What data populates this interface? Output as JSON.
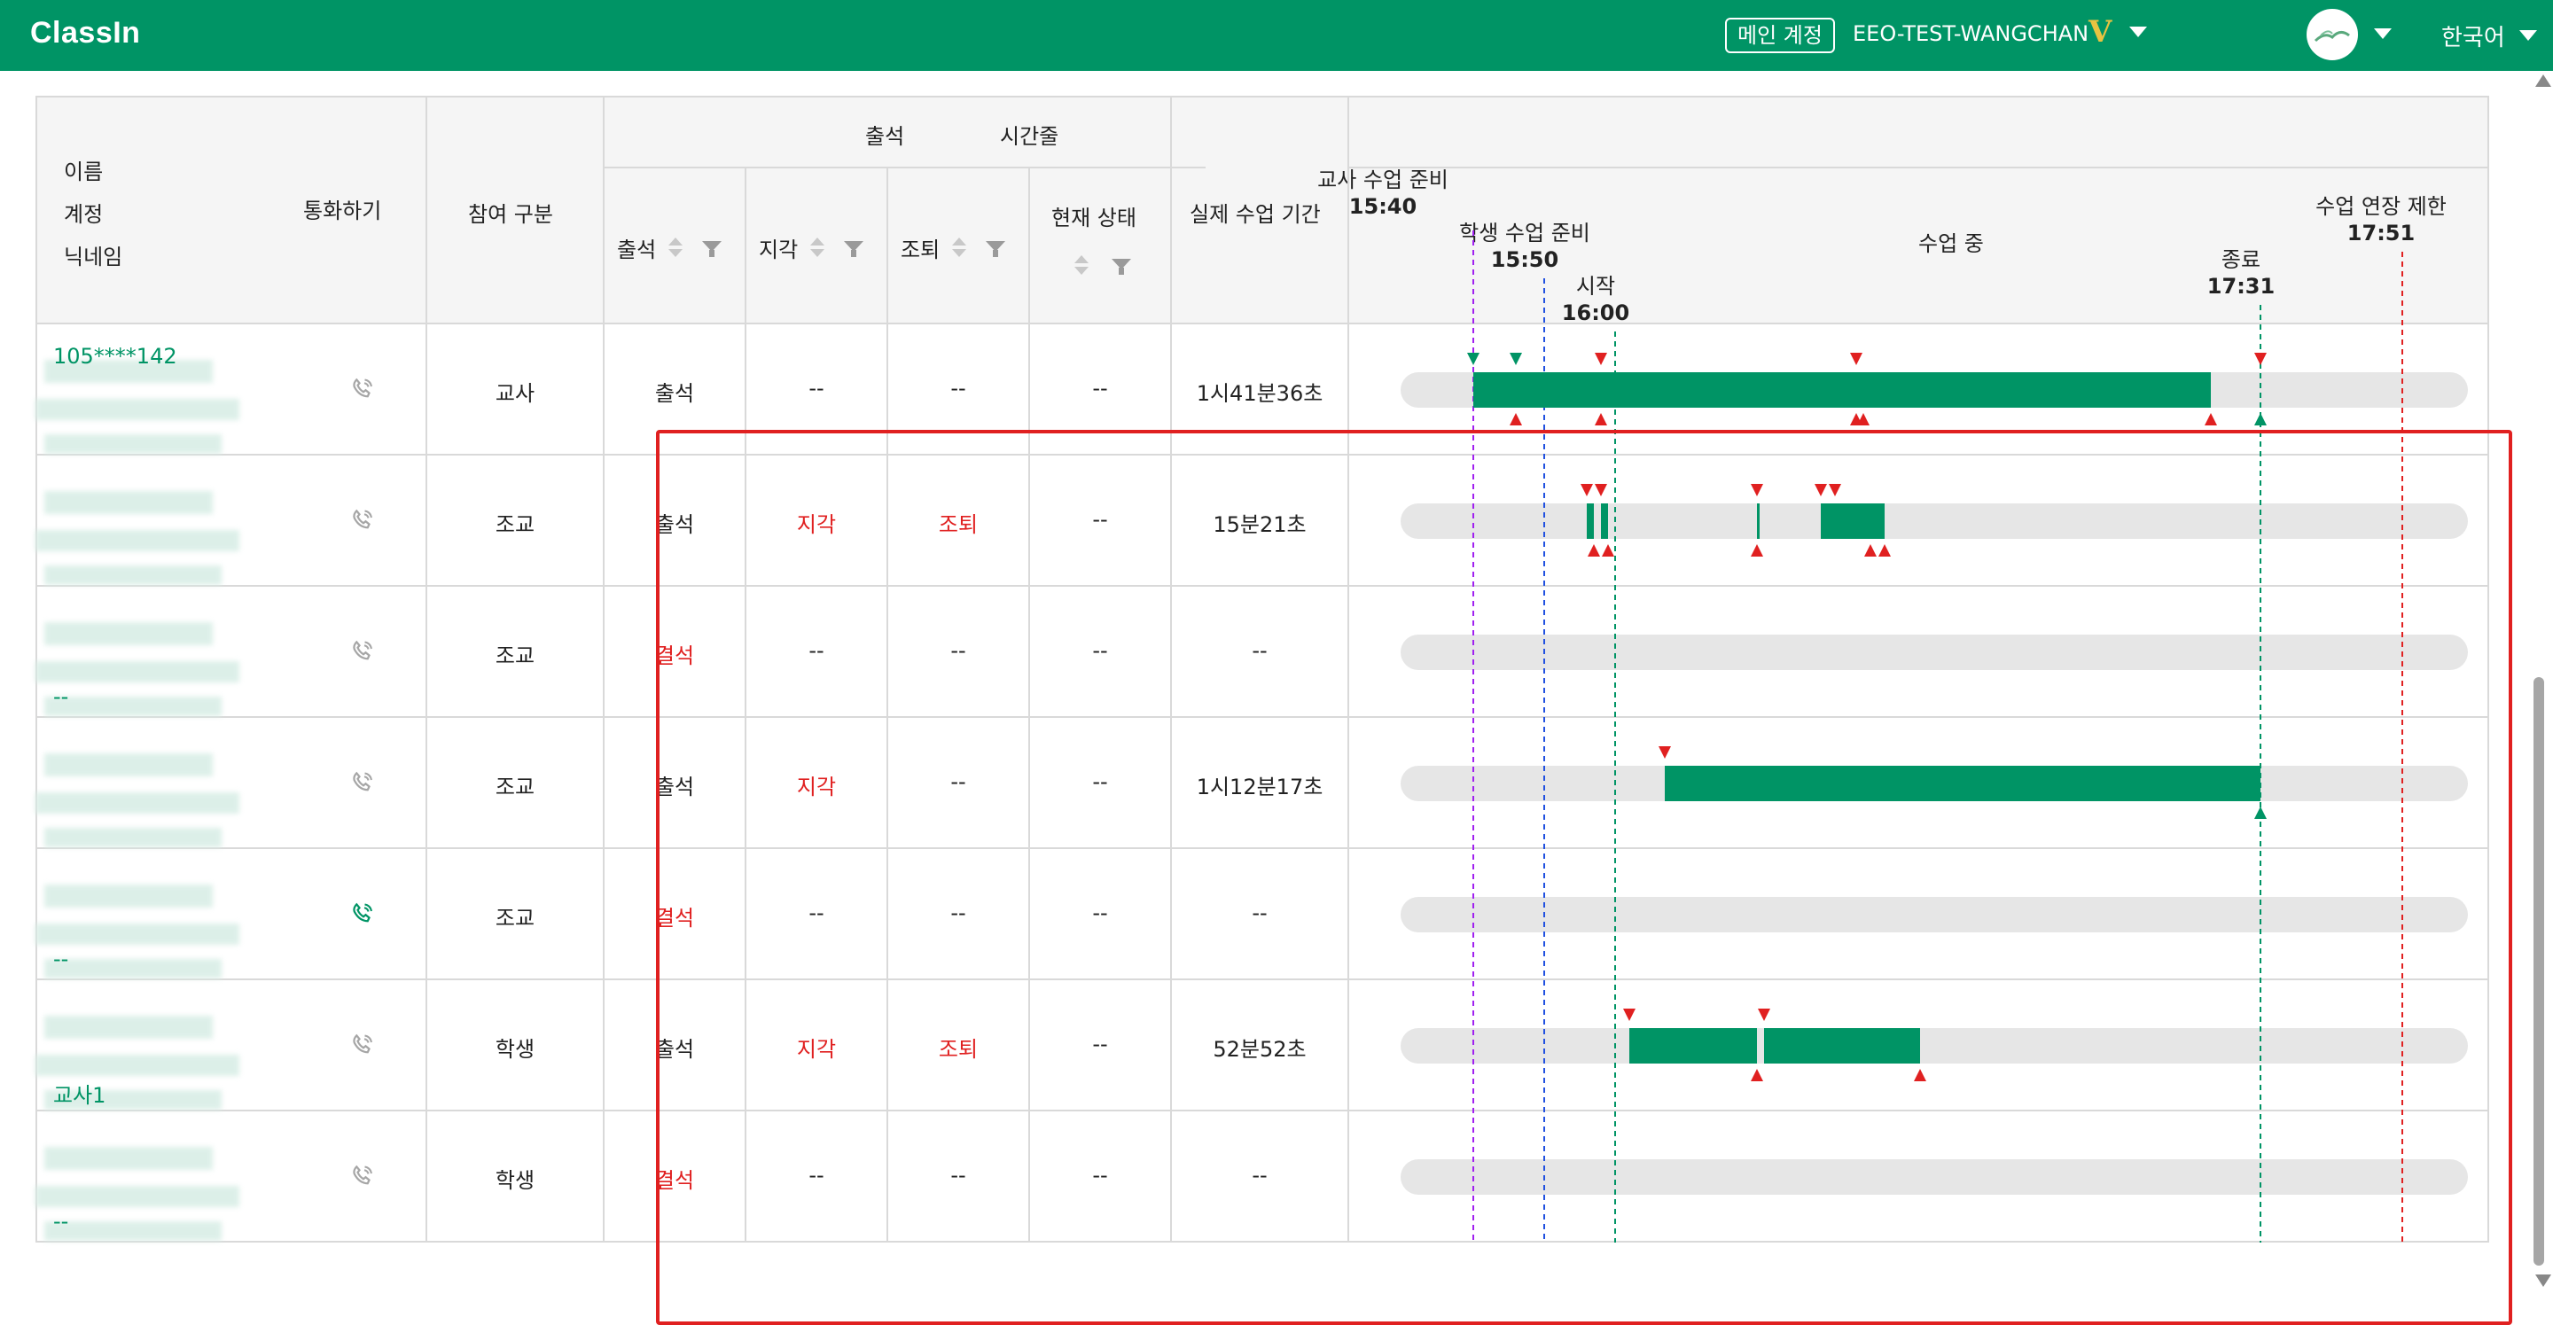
{
  "topbar": {
    "logo": "ClassIn",
    "main_account_label": "메인 계정",
    "account_name": "EEO-TEST-WANGCHAN",
    "vip_badge": "V",
    "language": "한국어",
    "brand_color": "#009465"
  },
  "table": {
    "headers": {
      "name": "이름",
      "account": "계정",
      "nickname": "닉네임",
      "call": "통화하기",
      "role": "참여 구분",
      "attendance_group": "출석",
      "attendance": "출석",
      "late": "지각",
      "early_leave": "조퇴",
      "current_status": "현재 상태",
      "actual_duration": "실제 수업 기간",
      "timeline": "시간줄"
    },
    "timeline_markers": {
      "teacher_prep": {
        "label": "교사 수업 준비",
        "time": "15:40"
      },
      "student_prep": {
        "label": "학생 수업 준비",
        "time": "15:50"
      },
      "start": {
        "label": "시작",
        "time": "16:00"
      },
      "in_class": {
        "label": "수업 중"
      },
      "end": {
        "label": "종료",
        "time": "17:31"
      },
      "extension_limit": {
        "label": "수업 연장 제한",
        "time": "17:51"
      }
    },
    "rows": [
      {
        "account_text": "105****142",
        "footer_text": "",
        "call_active": false,
        "role": "교사",
        "attendance": "출석",
        "attendance_red": false,
        "late": "--",
        "early_leave": "--",
        "status": "--",
        "duration": "1시41분36초"
      },
      {
        "account_text": "",
        "footer_text": "",
        "call_active": false,
        "role": "조교",
        "attendance": "출석",
        "attendance_red": false,
        "late": "지각",
        "early_leave": "조퇴",
        "status": "--",
        "duration": "15분21초"
      },
      {
        "account_text": "",
        "footer_text": "--",
        "call_active": false,
        "role": "조교",
        "attendance": "결석",
        "attendance_red": true,
        "late": "--",
        "early_leave": "--",
        "status": "--",
        "duration": "--"
      },
      {
        "account_text": "",
        "footer_text": "",
        "call_active": false,
        "role": "조교",
        "attendance": "출석",
        "attendance_red": false,
        "late": "지각",
        "early_leave": "--",
        "status": "--",
        "duration": "1시12분17초"
      },
      {
        "account_text": "",
        "footer_text": "--",
        "call_active": true,
        "role": "조교",
        "attendance": "결석",
        "attendance_red": true,
        "late": "--",
        "early_leave": "--",
        "status": "--",
        "duration": "--"
      },
      {
        "account_text": "",
        "footer_text": "교사1",
        "call_active": false,
        "role": "학생",
        "attendance": "출석",
        "attendance_red": false,
        "late": "지각",
        "early_leave": "조퇴",
        "status": "--",
        "duration": "52분52초"
      },
      {
        "account_text": "",
        "footer_text": "--",
        "call_active": false,
        "role": "학생",
        "attendance": "결석",
        "attendance_red": true,
        "late": "--",
        "early_leave": "--",
        "status": "--",
        "duration": "--"
      }
    ],
    "timeline_scale": {
      "start_time": "15:30",
      "end_time": "18:00"
    },
    "timeline_sessions": [
      {
        "row": 0,
        "segments": [
          [
            "15:40",
            "17:24"
          ]
        ],
        "join_markers": [
          "15:40",
          "15:46",
          "15:58",
          "16:34",
          "17:31"
        ],
        "leave_markers": [
          "15:46",
          "15:58",
          "16:34",
          "16:35",
          "17:24",
          "17:31"
        ]
      },
      {
        "row": 1,
        "segments": [
          [
            "15:56",
            "15:57"
          ],
          [
            "15:58",
            "15:59"
          ],
          [
            "16:20",
            "16:20"
          ],
          [
            "16:29",
            "16:38"
          ]
        ],
        "join_markers": [
          "15:56",
          "15:58",
          "16:20",
          "16:29",
          "16:31"
        ],
        "leave_markers": [
          "15:57",
          "15:59",
          "16:20",
          "16:36",
          "16:38"
        ]
      },
      {
        "row": 2,
        "segments": [],
        "join_markers": [],
        "leave_markers": []
      },
      {
        "row": 3,
        "segments": [
          [
            "16:07",
            "17:31"
          ]
        ],
        "join_markers": [
          "16:07"
        ],
        "leave_markers": [
          "17:31"
        ]
      },
      {
        "row": 4,
        "segments": [],
        "join_markers": [],
        "leave_markers": []
      },
      {
        "row": 5,
        "segments": [
          [
            "16:02",
            "16:20"
          ],
          [
            "16:21",
            "16:43"
          ]
        ],
        "join_markers": [
          "16:02",
          "16:21"
        ],
        "leave_markers": [
          "16:20",
          "16:43"
        ]
      },
      {
        "row": 6,
        "segments": [],
        "join_markers": [],
        "leave_markers": []
      }
    ],
    "colors": {
      "bar": "#009465",
      "track": "#e6e6e6",
      "join_marker": "#e02020",
      "teacher_marker": "#009465",
      "absent_text": "#e02020"
    }
  }
}
